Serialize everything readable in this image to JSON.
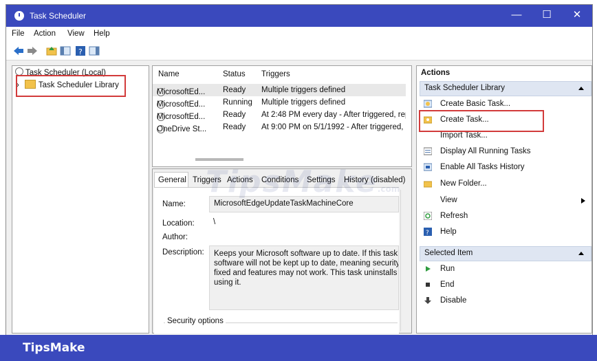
{
  "window": {
    "title": "Task Scheduler",
    "minimize": "—",
    "maximize": "☐",
    "close": "✕"
  },
  "menu": {
    "items": [
      "File",
      "Action",
      "View",
      "Help"
    ]
  },
  "tree": {
    "root": "Task Scheduler (Local)",
    "library": "Task Scheduler Library",
    "expand_glyph": "›"
  },
  "task_list": {
    "columns": [
      "Name",
      "Status",
      "Triggers"
    ],
    "rows": [
      {
        "name": "MicrosoftEd...",
        "status": "Ready",
        "triggers": "Multiple triggers defined"
      },
      {
        "name": "MicrosoftEd...",
        "status": "Running",
        "triggers": "Multiple triggers defined"
      },
      {
        "name": "MicrosoftEd...",
        "status": "Ready",
        "triggers": "At 2:48 PM every day - After triggered, repe"
      },
      {
        "name": "OneDrive St...",
        "status": "Ready",
        "triggers": "At 9:00 PM on 5/1/1992 - After triggered, re"
      }
    ]
  },
  "details": {
    "tabs": [
      "General",
      "Triggers",
      "Actions",
      "Conditions",
      "Settings",
      "History (disabled)"
    ],
    "name_label": "Name:",
    "name_value": "MicrosoftEdgeUpdateTaskMachineCore",
    "location_label": "Location:",
    "location_value": "\\",
    "author_label": "Author:",
    "description_label": "Description:",
    "description_lines": [
      "Keeps your Microsoft software up to date. If this task i",
      "software will not be kept up to date, meaning security",
      "fixed and features may not work. This task uninstalls i",
      "using it."
    ],
    "security_label": "Security options"
  },
  "actions": {
    "title": "Actions",
    "section1": "Task Scheduler Library",
    "items1": [
      "Create Basic Task...",
      "Create Task...",
      "Import Task...",
      "Display All Running Tasks",
      "Enable All Tasks History",
      "New Folder...",
      "View",
      "Refresh",
      "Help"
    ],
    "section2": "Selected Item",
    "items2": [
      "Run",
      "End",
      "Disable"
    ]
  },
  "watermark": {
    "main": "TipsMake",
    "suffix": ".com"
  },
  "footer": {
    "brand": "TipsMake"
  },
  "colors": {
    "title_bar": "#3a49bd",
    "highlight_box": "#d23a3a",
    "section_header": "#dfe6f2"
  }
}
